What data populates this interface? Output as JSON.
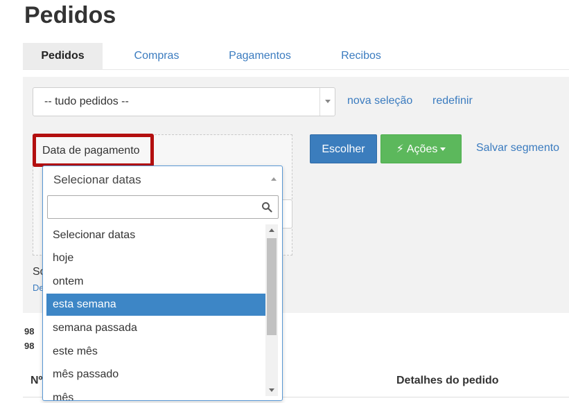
{
  "page": {
    "title": "Pedidos"
  },
  "tabs": [
    {
      "label": "Pedidos",
      "active": true
    },
    {
      "label": "Compras",
      "active": false
    },
    {
      "label": "Pagamentos",
      "active": false
    },
    {
      "label": "Recibos",
      "active": false
    }
  ],
  "filter": {
    "selection_value": "-- tudo pedidos --",
    "new_selection_link": "nova seleção",
    "reset_link": "redefinir",
    "field_label": "Data de pagamento",
    "choose_button": "Escolher",
    "actions_button": "Ações",
    "save_segment_link": "Salvar segmento",
    "under_text": "So",
    "under_link": "De"
  },
  "date_dropdown": {
    "selected_value": "Selecionar datas",
    "search_placeholder": "",
    "items": [
      "Selecionar datas",
      "hoje",
      "ontem",
      "esta semana",
      "semana passada",
      "este mês",
      "mês passado",
      "mês"
    ],
    "highlighted_index": 3
  },
  "summary": {
    "line1": "98",
    "line2": "98"
  },
  "table": {
    "headers": {
      "number": "Nº",
      "details": "Detalhes do pedido"
    }
  },
  "colors": {
    "primary": "#3b7dbd",
    "success": "#5cb85c",
    "highlight_border": "#b30f0f",
    "link": "#3a7bbf"
  }
}
